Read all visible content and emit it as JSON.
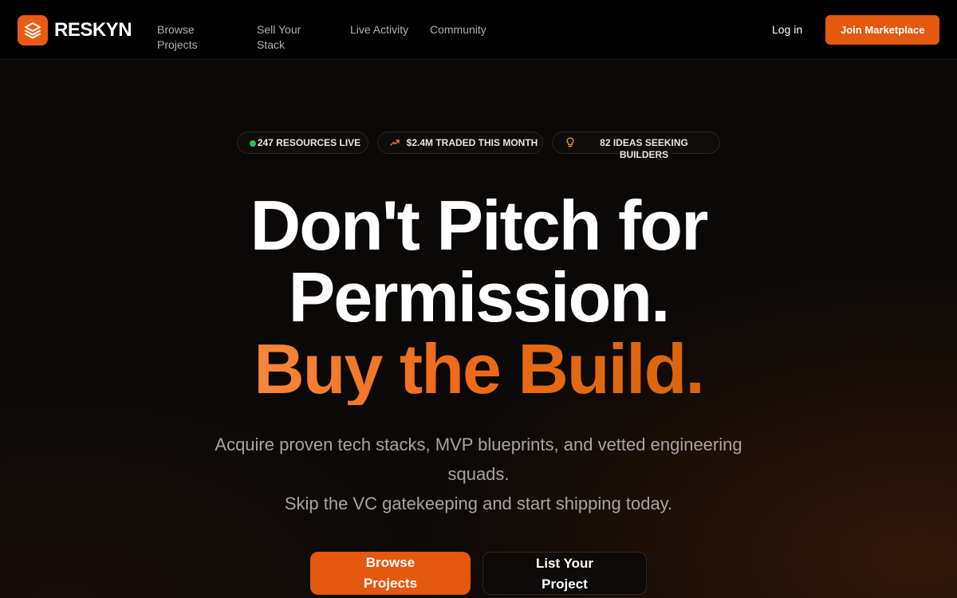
{
  "brand": {
    "name": "RESKYN",
    "accent": "#e55810"
  },
  "nav": {
    "links": [
      {
        "label": "Browse Projects"
      },
      {
        "label": "Sell Your Stack"
      },
      {
        "label": "Live Activity"
      },
      {
        "label": "Community"
      }
    ],
    "login_label": "Log in",
    "join_label": "Join Marketplace"
  },
  "stats": [
    {
      "icon": "green-dot-icon",
      "label": "247 RESOURCES LIVE"
    },
    {
      "icon": "trending-up-icon",
      "label": "$2.4M TRADED THIS MONTH"
    },
    {
      "icon": "lightbulb-icon",
      "label": "82 IDEAS SEEKING BUILDERS"
    }
  ],
  "hero": {
    "line1": "Don't Pitch for",
    "line2": "Permission.",
    "line3": "Buy the Build.",
    "sub1": "Acquire proven tech stacks, MVP blueprints, and vetted engineering squads.",
    "sub2": "Skip the VC gatekeeping and start shipping today."
  },
  "cta": {
    "primary_label": "Browse Projects",
    "secondary_label": "List Your Project"
  }
}
